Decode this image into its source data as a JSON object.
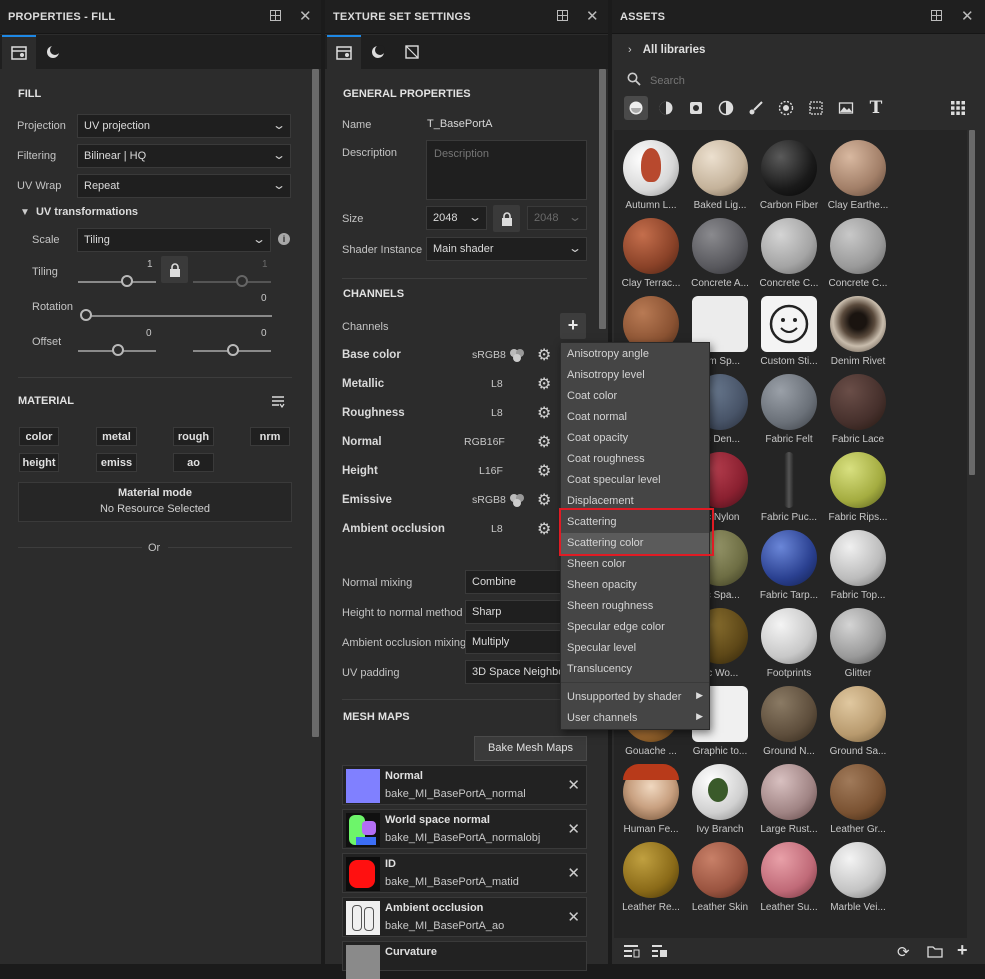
{
  "properties": {
    "title": "PROPERTIES - FILL",
    "section_fill": "FILL",
    "projection_label": "Projection",
    "projection_value": "UV projection",
    "filtering_label": "Filtering",
    "filtering_value": "Bilinear | HQ",
    "uvwrap_label": "UV Wrap",
    "uvwrap_value": "Repeat",
    "uvtrans_label": "UV transformations",
    "scale_label": "Scale",
    "scale_value": "Tiling",
    "tiling_label": "Tiling",
    "tiling_value": "1",
    "tiling_value2": "1",
    "rotation_label": "Rotation",
    "rotation_value": "0",
    "offset_label": "Offset",
    "offset_u": "0",
    "offset_v": "0",
    "section_material": "MATERIAL",
    "chips": [
      "color",
      "metal",
      "rough",
      "nrm",
      "height",
      "emiss",
      "ao"
    ],
    "material_mode_title": "Material mode",
    "material_mode_value": "No Resource Selected",
    "or_label": "Or"
  },
  "texture_set": {
    "title": "TEXTURE SET SETTINGS",
    "section_general": "GENERAL PROPERTIES",
    "name_label": "Name",
    "name_value": "T_BasePortA",
    "description_label": "Description",
    "description_placeholder": "Description",
    "size_label": "Size",
    "size_value": "2048",
    "size_value2": "2048",
    "shader_label": "Shader Instance",
    "shader_value": "Main shader",
    "section_channels": "CHANNELS",
    "channels_label": "Channels",
    "channels": [
      {
        "name": "Base color",
        "format": "sRGB8"
      },
      {
        "name": "Metallic",
        "format": "L8"
      },
      {
        "name": "Roughness",
        "format": "L8"
      },
      {
        "name": "Normal",
        "format": "RGB16F"
      },
      {
        "name": "Height",
        "format": "L16F"
      },
      {
        "name": "Emissive",
        "format": "sRGB8"
      },
      {
        "name": "Ambient occlusion",
        "format": "L8"
      }
    ],
    "normal_mixing_label": "Normal mixing",
    "normal_mixing_value": "Combine",
    "height_normal_label": "Height to normal method",
    "height_normal_value": "Sharp",
    "ao_mixing_label": "Ambient occlusion mixing",
    "ao_mixing_value": "Multiply",
    "uv_padding_label": "UV padding",
    "uv_padding_value": "3D Space Neighbo",
    "section_mesh_maps": "MESH MAPS",
    "bake_button": "Bake Mesh Maps",
    "mesh_maps": [
      {
        "title": "Normal",
        "file": "bake_MI_BasePortA_normal"
      },
      {
        "title": "World space normal",
        "file": "bake_MI_BasePortA_normalobj"
      },
      {
        "title": "ID",
        "file": "bake_MI_BasePortA_matid"
      },
      {
        "title": "Ambient occlusion",
        "file": "bake_MI_BasePortA_ao"
      },
      {
        "title": "Curvature",
        "file": ""
      }
    ]
  },
  "channel_menu": {
    "items": [
      "Anisotropy angle",
      "Anisotropy level",
      "Coat color",
      "Coat normal",
      "Coat opacity",
      "Coat roughness",
      "Coat specular level",
      "Displacement",
      "Scattering",
      "Scattering color",
      "Sheen color",
      "Sheen opacity",
      "Sheen roughness",
      "Specular edge color",
      "Specular level",
      "Translucency"
    ],
    "submenus": [
      "Unsupported by shader",
      "User channels"
    ],
    "highlighted": "Scattering color",
    "highlight_color": "#e01b24"
  },
  "assets": {
    "title": "ASSETS",
    "breadcrumb": "All libraries",
    "search_placeholder": "Search",
    "items": [
      "Autumn L...",
      "Baked Lig...",
      "Carbon Fiber",
      "Clay Earthe...",
      "Clay Terrac...",
      "Concrete A...",
      "Concrete C...",
      "Concrete C...",
      "",
      "tom Sp...",
      "Custom Sti...",
      "Denim Rivet",
      "",
      "ric Den...",
      "Fabric Felt",
      "Fabric Lace",
      "",
      "ric Nylon",
      "Fabric Puc...",
      "Fabric Rips...",
      "",
      "ric Spa...",
      "Fabric Tarp...",
      "Fabric Top...",
      "",
      "ric Wo...",
      "Footprints",
      "Glitter",
      "Gouache ...",
      "Graphic to...",
      "Ground N...",
      "Ground Sa...",
      "Human Fe...",
      "Ivy Branch",
      "Large Rust...",
      "Leather Gr...",
      "Leather Re...",
      "Leather Skin",
      "Leather Su...",
      "Marble Vei..."
    ]
  }
}
